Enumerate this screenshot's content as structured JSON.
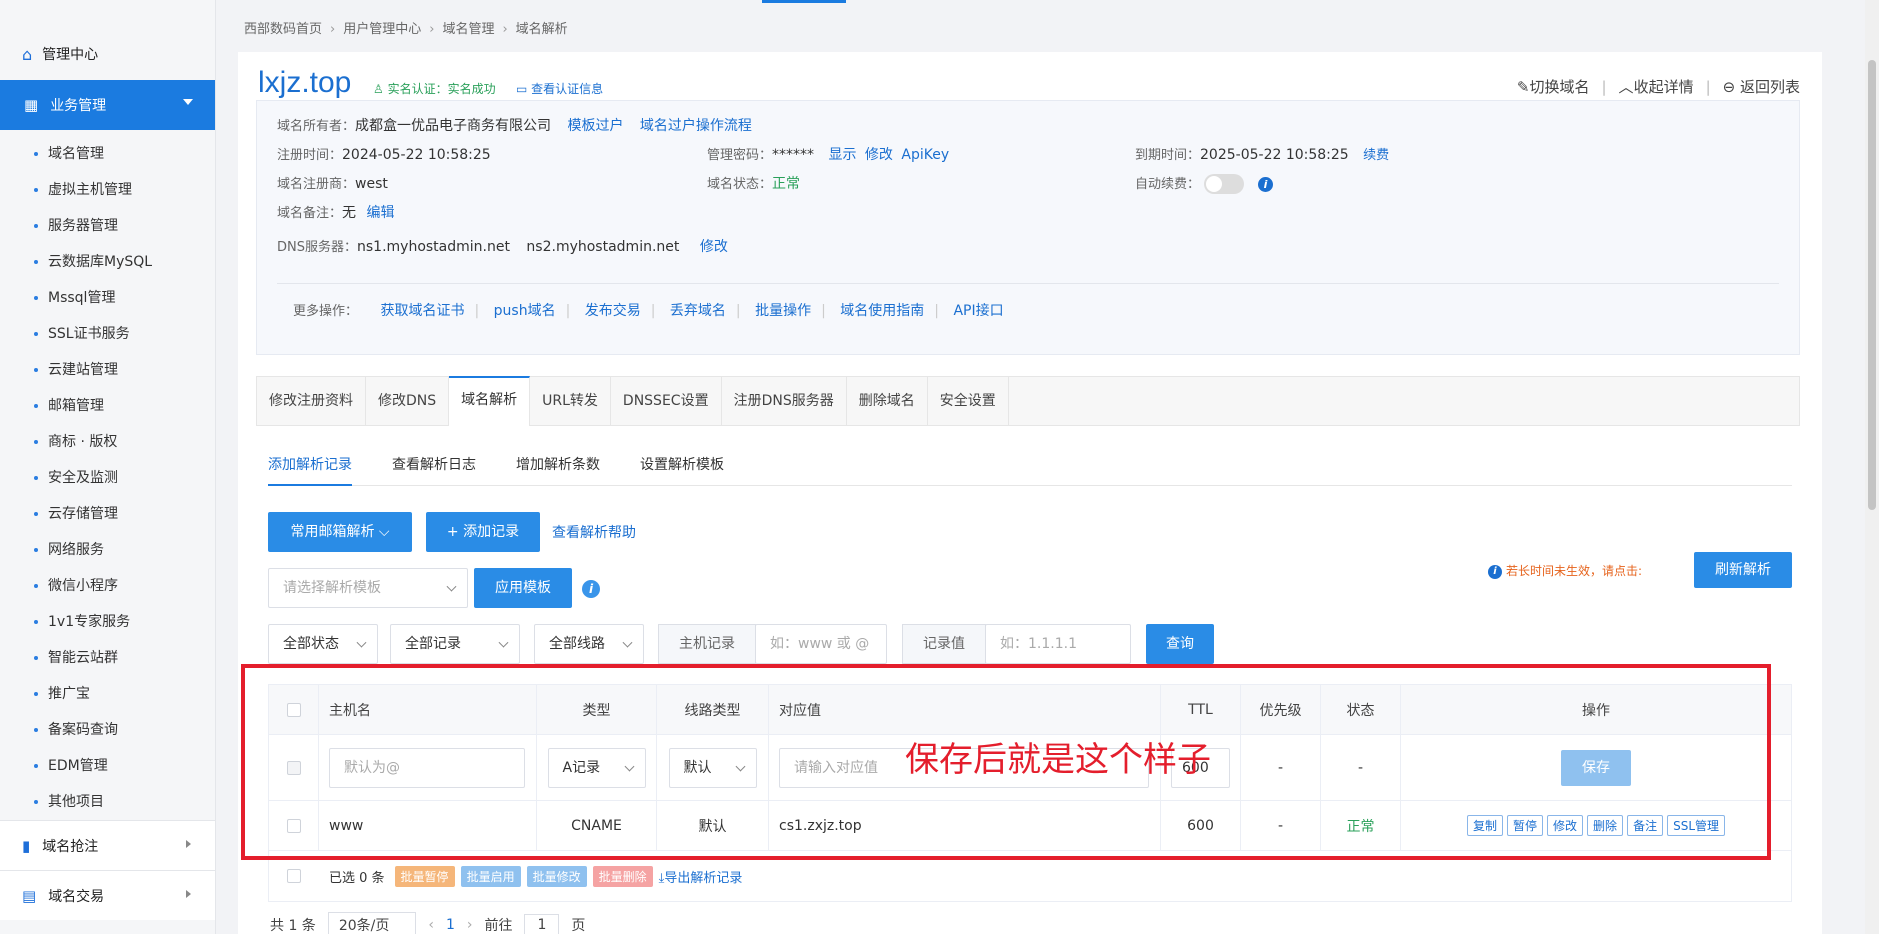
{
  "breadcrumb": [
    "西部数码首页",
    "用户管理中心",
    "域名管理",
    "域名解析"
  ],
  "sidebar": {
    "top_label": "管理中心",
    "active_label": "业务管理",
    "items": [
      "域名管理",
      "虚拟主机管理",
      "服务器管理",
      "云数据库MySQL",
      "Mssql管理",
      "SSL证书服务",
      "云建站管理",
      "邮箱管理",
      "商标 · 版权",
      "安全及监测",
      "云存储管理",
      "网络服务",
      "微信小程序",
      "1v1专家服务",
      "智能云站群",
      "推广宝",
      "备案码查询",
      "EDM管理",
      "其他项目"
    ],
    "groups": [
      "域名抢注",
      "域名交易"
    ]
  },
  "domain": {
    "name": "lxjz.top",
    "verify_text": "实名认证：实名成功",
    "verify_link": "查看认证信息",
    "switch": "切换域名",
    "collapse": "收起详情",
    "back": "返回列表"
  },
  "info": {
    "owner_label": "域名所有者：",
    "owner_value": "成都盒一优品电子商务有限公司",
    "owner_link1": "模板过户",
    "owner_link2": "域名过户操作流程",
    "reg_time_label": "注册时间：",
    "reg_time_value": "2024-05-22 10:58:25",
    "pwd_label": "管理密码：",
    "pwd_value": "******",
    "pwd_show": "显示",
    "pwd_edit": "修改",
    "pwd_api": "ApiKey",
    "expire_label": "到期时间：",
    "expire_value": "2025-05-22 10:58:25",
    "renew": "续费",
    "registrar_label": "域名注册商：",
    "registrar_value": "west",
    "status_label": "域名状态：",
    "status_value": "正常",
    "auto_renew_label": "自动续费：",
    "note_label": "域名备注：",
    "note_value": "无",
    "note_edit": "编辑",
    "dns_label": "DNS服务器：",
    "dns1": "ns1.myhostadmin.net",
    "dns2": "ns2.myhostadmin.net",
    "dns_edit": "修改",
    "more_label": "更多操作：",
    "more_ops": [
      "获取域名证书",
      "push域名",
      "发布交易",
      "丢弃域名",
      "批量操作",
      "域名使用指南",
      "API接口"
    ]
  },
  "tabs": [
    "修改注册资料",
    "修改DNS",
    "域名解析",
    "URL转发",
    "DNSSEC设置",
    "注册DNS服务器",
    "删除域名",
    "安全设置"
  ],
  "subtabs": [
    "添加解析记录",
    "查看解析日志",
    "增加解析条数",
    "设置解析模板"
  ],
  "toolbar": {
    "mail_btn": "常用邮箱解析",
    "add_btn": "+ 添加记录",
    "help_link": "查看解析帮助",
    "template_placeholder": "请选择解析模板",
    "apply_btn": "应用模板",
    "warn_text": "若长时间未生效，请点击:",
    "refresh_btn": "刷新解析"
  },
  "filters": {
    "status": "全部状态",
    "records": "全部记录",
    "lines": "全部线路",
    "host_label": "主机记录",
    "host_placeholder": "如：www 或 @",
    "value_label": "记录值",
    "value_placeholder": "如：1.1.1.1",
    "query_btn": "查询"
  },
  "table": {
    "headers": [
      "主机名",
      "类型",
      "线路类型",
      "对应值",
      "TTL",
      "优先级",
      "状态",
      "操作"
    ],
    "edit_row": {
      "host_placeholder": "默认为@",
      "type": "A记录",
      "line": "默认",
      "value_placeholder": "请输入对应值",
      "ttl": "600",
      "priority": "-",
      "status": "-",
      "save": "保存"
    },
    "rows": [
      {
        "host": "www",
        "type": "CNAME",
        "line": "默认",
        "value": "cs1.zxjz.top",
        "ttl": "600",
        "priority": "-",
        "status": "正常"
      }
    ],
    "row_actions": [
      "复制",
      "暂停",
      "修改",
      "删除",
      "备注",
      "SSL管理"
    ],
    "footer_selected": "已选 0 条",
    "batch": [
      "批量暂停",
      "批量启用",
      "批量修改",
      "批量删除"
    ],
    "export": "导出解析记录"
  },
  "pager": {
    "total": "共 1 条",
    "per_page": "20条/页",
    "current": "1",
    "goto_prefix": "前往",
    "goto_value": "1",
    "goto_suffix": "页"
  },
  "annotation": "保存后就是这个样子",
  "colors": {
    "accent": "#1b7be0",
    "link": "#1b6fd0",
    "success": "#2aa05a",
    "annotation": "#e41e2c"
  }
}
